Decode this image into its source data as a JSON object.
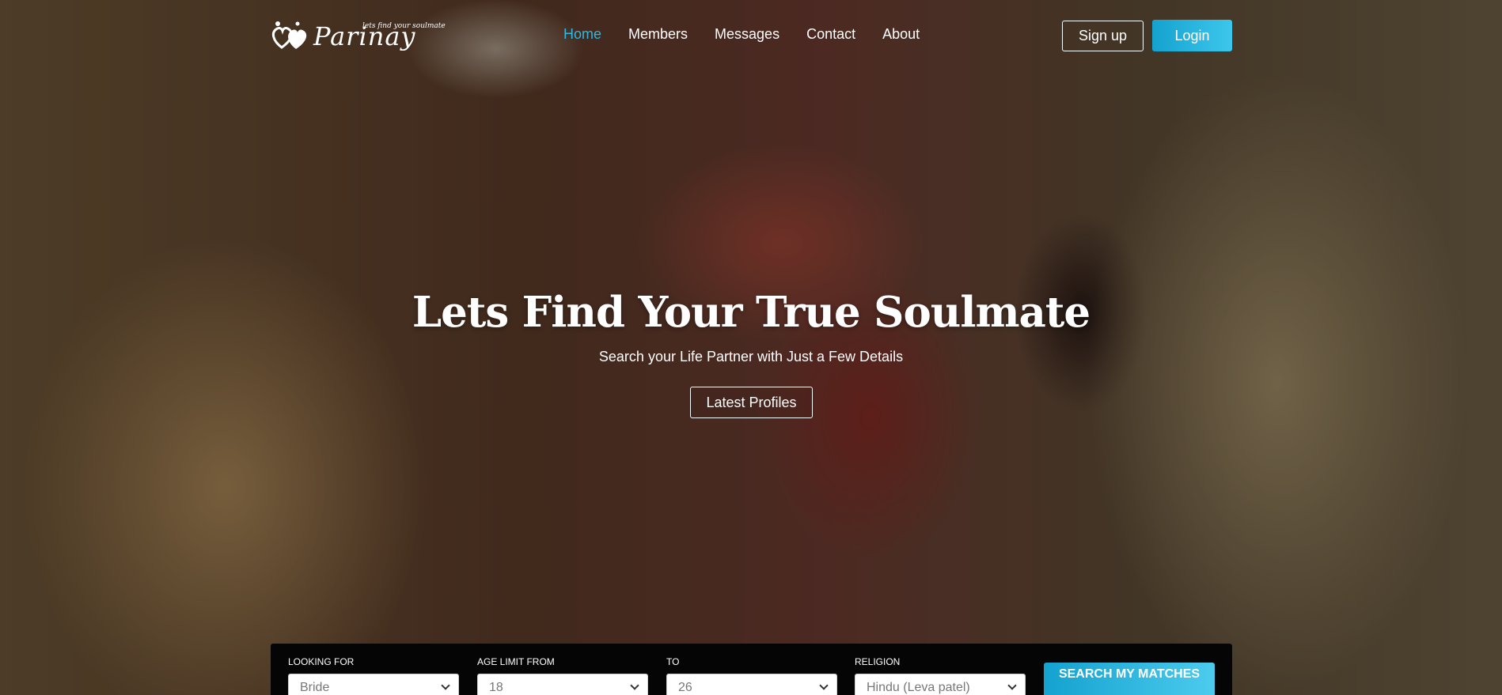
{
  "brand": {
    "name": "Parinay",
    "tagline": "lets find your soulmate"
  },
  "nav": {
    "items": [
      {
        "label": "Home",
        "active": true
      },
      {
        "label": "Members",
        "active": false
      },
      {
        "label": "Messages",
        "active": false
      },
      {
        "label": "Contact",
        "active": false
      },
      {
        "label": "About",
        "active": false
      }
    ]
  },
  "auth": {
    "signup_label": "Sign up",
    "login_label": "Login"
  },
  "hero": {
    "headline": "Lets Find Your True Soulmate",
    "subheadline": "Search your Life Partner with Just a Few Details",
    "cta_label": "Latest Profiles"
  },
  "search": {
    "looking_for": {
      "label": "LOOKING FOR",
      "value": "Bride"
    },
    "age_from": {
      "label": "AGE LIMIT FROM",
      "value": "18"
    },
    "age_to": {
      "label": "TO",
      "value": "26"
    },
    "religion": {
      "label": "RELIGION",
      "value": "Hindu (Leva patel)"
    },
    "submit_label": "SEARCH MY MATCHES"
  },
  "colors": {
    "accent": "#14a2cf",
    "accent_light": "#3cc7ec",
    "panel": "#050505"
  }
}
